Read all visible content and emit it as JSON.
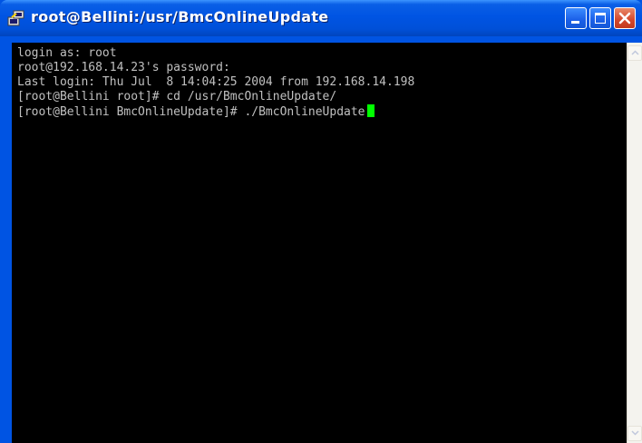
{
  "window": {
    "title": "root@Bellini:/usr/BmcOnlineUpdate"
  },
  "titlebar_buttons": {
    "minimize": "minimize-icon",
    "maximize": "maximize-icon",
    "close": "close-icon"
  },
  "terminal": {
    "lines": [
      "login as: root",
      "root@192.168.14.23's password:",
      "Last login: Thu Jul  8 14:04:25 2004 from 192.168.14.198",
      "[root@Bellini root]# cd /usr/BmcOnlineUpdate/",
      "[root@Bellini BmcOnlineUpdate]# ./BmcOnlineUpdate"
    ],
    "text_color": "#c0c0c0",
    "background": "#000000",
    "cursor_color": "#00ff00"
  },
  "colors": {
    "titlebar": "#0054e3",
    "close_button": "#d4462a"
  }
}
